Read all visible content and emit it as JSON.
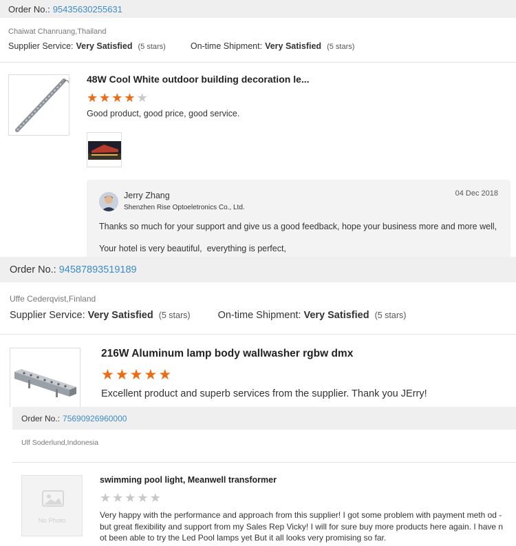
{
  "reviews": [
    {
      "order_label": "Order No.:",
      "order_no": "95435630255631",
      "buyer": "Chaiwat Chanruang,Thailand",
      "supplier_service_label": "Supplier Service:",
      "supplier_service_value": "Very Satisfied",
      "supplier_service_stars": "(5 stars)",
      "shipment_label": "On-time Shipment:",
      "shipment_value": "Very Satisfied",
      "shipment_stars": "(5 stars)",
      "product_title": "48W Cool White outdoor building decoration le...",
      "rating": 4,
      "comment": "Good product, good price, good service.",
      "reply": {
        "name": "Jerry Zhang",
        "company": "Shenzhen Rise Optoeletronics Co., Ltd.",
        "date": "04 Dec 2018",
        "text1": "Thanks so much for your support and give us a good feedback, hope your business more and more well,",
        "text2": "Your hotel is very beautiful,  everything is perfect,"
      }
    },
    {
      "order_label": "Order No.:",
      "order_no": "94587893519189",
      "buyer": "Uffe Cederqvist,Finland",
      "supplier_service_label": "Supplier Service:",
      "supplier_service_value": "Very Satisfied",
      "supplier_service_stars": "(5 stars)",
      "shipment_label": "On-time Shipment:",
      "shipment_value": "Very Satisfied",
      "shipment_stars": "(5 stars)",
      "product_title": "216W Aluminum lamp body wallwasher rgbw dmx",
      "rating": 5,
      "comment": "Excellent product and superb services from the supplier. Thank you JErry!"
    },
    {
      "order_label": "Order No.:",
      "order_no": "75690926960000",
      "buyer": "Ulf Soderlund,Indonesia",
      "product_title": "swimming pool light, Meanwell transformer",
      "rating": 0,
      "no_photo": "No Photo",
      "comment": "Very happy with the performance and approach from this supplier! I got some problem with payment meth od - but great flexibility and support from my Sales Rep Vicky! I will for sure buy more products here again. I have not been able to try the Led Pool lamps yet But it all looks very promising so far."
    }
  ],
  "colors": {
    "star_on": "#f26a10",
    "star_off": "#c8c8c8",
    "order_no": "#3c8dc5",
    "order_bar": "#efefef",
    "reply_bg": "#f3f3f3"
  },
  "icons": [
    "star-icon",
    "product-thumbnail",
    "photo-placeholder-icon",
    "avatar"
  ]
}
